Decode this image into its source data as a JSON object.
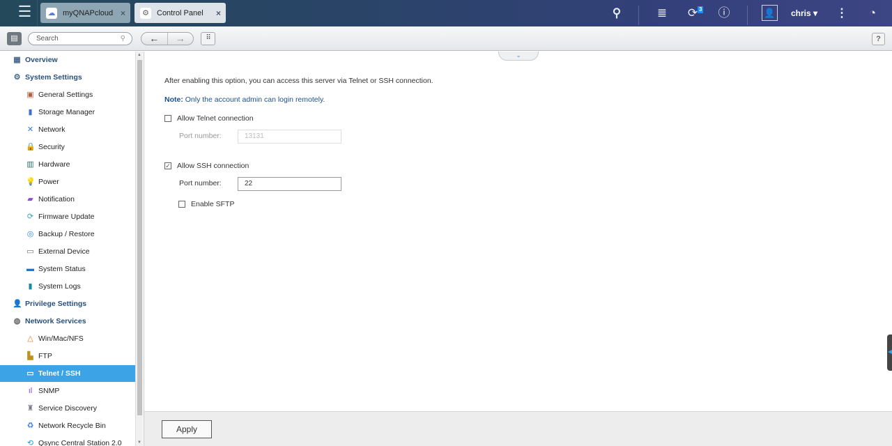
{
  "topbar": {
    "tabs": [
      {
        "label": "myQNAPcloud",
        "icon": "cloud-icon"
      },
      {
        "label": "Control Panel",
        "icon": "gear-icon"
      }
    ],
    "notification_count": "3",
    "username": "chris"
  },
  "toolbar": {
    "search_placeholder": "Search",
    "help": "?"
  },
  "sidebar": {
    "items": [
      {
        "label": "Overview",
        "level": "top",
        "icon": "overview-icon"
      },
      {
        "label": "System Settings",
        "level": "top",
        "icon": "gear-icon"
      },
      {
        "label": "General Settings",
        "level": "sub",
        "icon": "general-settings-icon"
      },
      {
        "label": "Storage Manager",
        "level": "sub",
        "icon": "storage-icon"
      },
      {
        "label": "Network",
        "level": "sub",
        "icon": "network-icon"
      },
      {
        "label": "Security",
        "level": "sub",
        "icon": "lock-icon"
      },
      {
        "label": "Hardware",
        "level": "sub",
        "icon": "hardware-icon"
      },
      {
        "label": "Power",
        "level": "sub",
        "icon": "power-icon"
      },
      {
        "label": "Notification",
        "level": "sub",
        "icon": "notification-icon"
      },
      {
        "label": "Firmware Update",
        "level": "sub",
        "icon": "firmware-icon"
      },
      {
        "label": "Backup / Restore",
        "level": "sub",
        "icon": "backup-icon"
      },
      {
        "label": "External Device",
        "level": "sub",
        "icon": "external-device-icon"
      },
      {
        "label": "System Status",
        "level": "sub",
        "icon": "monitor-icon"
      },
      {
        "label": "System Logs",
        "level": "sub",
        "icon": "logs-icon"
      },
      {
        "label": "Privilege Settings",
        "level": "top",
        "icon": "user-icon"
      },
      {
        "label": "Network Services",
        "level": "top",
        "icon": "globe-icon"
      },
      {
        "label": "Win/Mac/NFS",
        "level": "sub",
        "icon": "triangle-icon"
      },
      {
        "label": "FTP",
        "level": "sub",
        "icon": "ftp-icon"
      },
      {
        "label": "Telnet / SSH",
        "level": "sub",
        "icon": "terminal-icon",
        "selected": true
      },
      {
        "label": "SNMP",
        "level": "sub",
        "icon": "chart-icon"
      },
      {
        "label": "Service Discovery",
        "level": "sub",
        "icon": "discovery-icon"
      },
      {
        "label": "Network Recycle Bin",
        "level": "sub",
        "icon": "recycle-icon"
      },
      {
        "label": "Qsync Central Station 2.0",
        "level": "sub",
        "icon": "sync-icon"
      }
    ]
  },
  "main": {
    "intro": "After enabling this option, you can access this server via Telnet or SSH connection.",
    "note_prefix": "Note:",
    "note_text": " Only the account admin can login remotely.",
    "telnet": {
      "label": "Allow Telnet connection",
      "checked": false,
      "port_label": "Port number:",
      "port": "13131"
    },
    "ssh": {
      "label": "Allow SSH connection",
      "checked": true,
      "port_label": "Port number:",
      "port": "22"
    },
    "sftp": {
      "label": "Enable SFTP",
      "checked": false
    }
  },
  "footer": {
    "apply": "Apply"
  }
}
